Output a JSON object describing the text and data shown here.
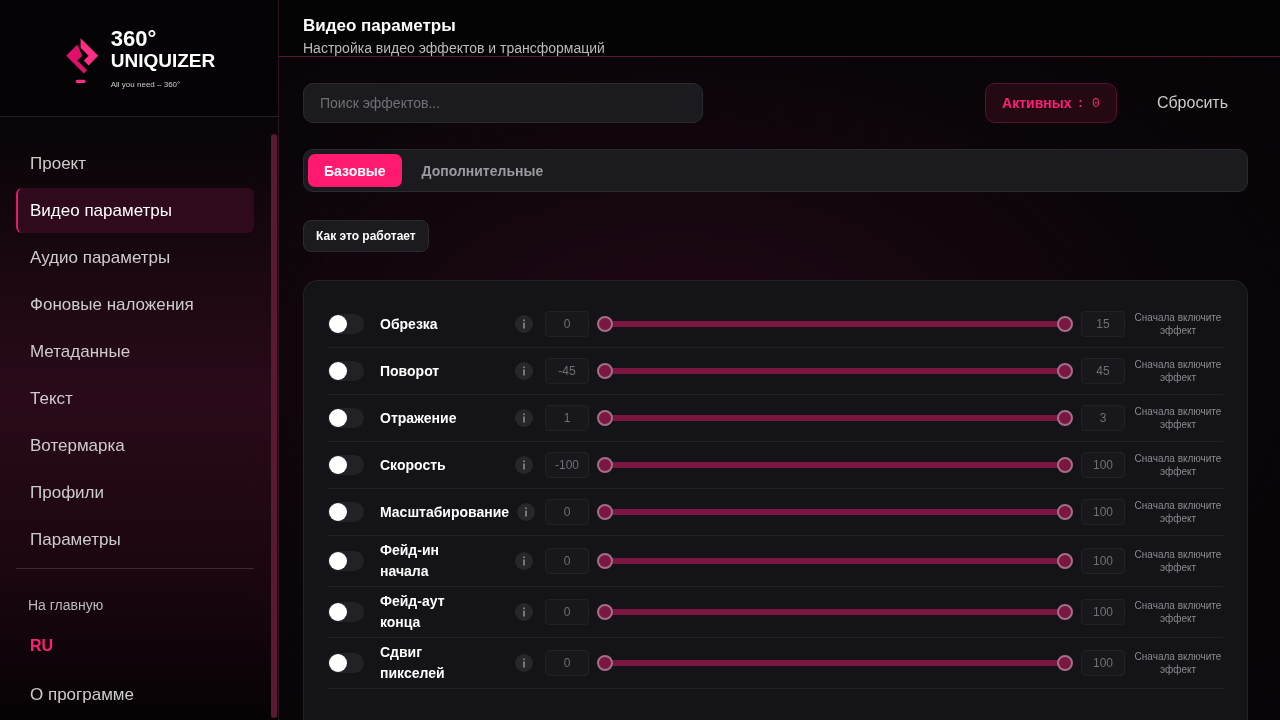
{
  "logo": {
    "title": "360°",
    "name": "UNIQUIZER",
    "tagline": "All you need – 360°"
  },
  "sidebar": {
    "items": [
      {
        "label": "Проект",
        "selected": false
      },
      {
        "label": "Видео параметры",
        "selected": true
      },
      {
        "label": "Аудио параметры",
        "selected": false
      },
      {
        "label": "Фоновые наложения",
        "selected": false
      },
      {
        "label": "Метаданные",
        "selected": false
      },
      {
        "label": "Текст",
        "selected": false
      },
      {
        "label": "Вотермарка",
        "selected": false
      },
      {
        "label": "Профили",
        "selected": false
      },
      {
        "label": "Параметры",
        "selected": false
      }
    ],
    "home": "На главную",
    "language": {
      "label": "RU",
      "selected": true
    },
    "about": "О программе"
  },
  "header": {
    "title": "Видео параметры",
    "subtitle": "Настройка видео эффектов и трансформаций"
  },
  "search": {
    "placeholder": "Поиск эффектов..."
  },
  "active": {
    "label": "Активных",
    "separator": ":",
    "count": "0"
  },
  "reset": "Сбросить",
  "tabs": [
    {
      "label": "Базовые",
      "selected": true
    },
    {
      "label": "Дополнительные",
      "selected": false
    }
  ],
  "how_it_works": "Как это работает",
  "effects": [
    {
      "name": "Обрезка",
      "on": false,
      "min": "0",
      "max": "15",
      "level": 1,
      "hint": "Сначала включите эффект"
    },
    {
      "name": "Поворот",
      "on": false,
      "min": "-45",
      "max": "45",
      "level": 1,
      "hint": "Сначала включите эффект"
    },
    {
      "name": "Отражение",
      "on": false,
      "min": "1",
      "max": "3",
      "level": 1,
      "hint": "Сначала включите эффект"
    },
    {
      "name": "Скорость",
      "on": false,
      "min": "-100",
      "max": "100",
      "level": 1,
      "hint": "Сначала включите эффект"
    },
    {
      "name": "Масштабирование",
      "on": false,
      "min": "0",
      "max": "100",
      "level": 1,
      "hint": "Сначала включите эффект"
    },
    {
      "name": "Фейд-ин начала",
      "on": false,
      "min": "0",
      "max": "100",
      "level": 1,
      "hint": "Сначала включите эффект"
    },
    {
      "name": "Фейд-аут конца",
      "on": false,
      "min": "0",
      "max": "100",
      "level": 1,
      "hint": "Сначала включите эффект"
    },
    {
      "name": "Сдвиг пикселей",
      "on": false,
      "min": "0",
      "max": "100",
      "level": 1,
      "hint": "Сначала включите эффект"
    }
  ]
}
